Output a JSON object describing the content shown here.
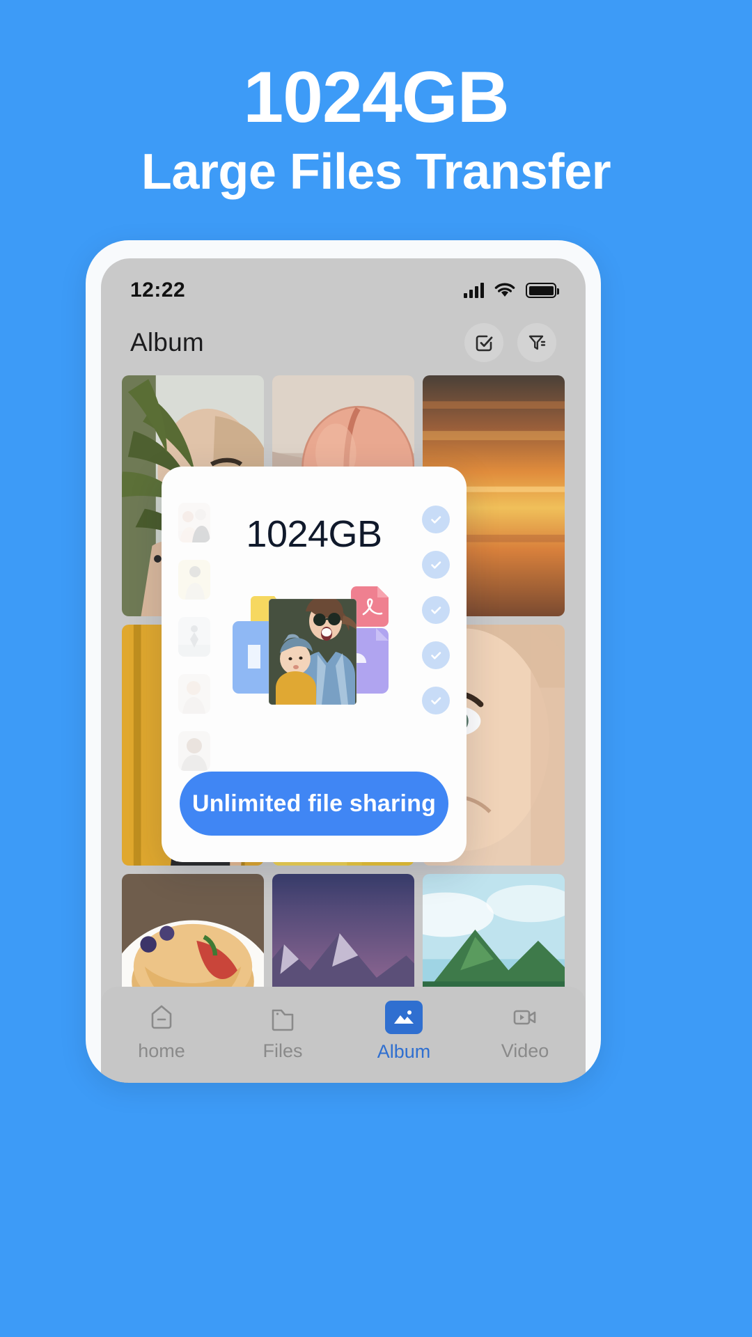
{
  "headline": {
    "line1": "1024GB",
    "line2": "Large Files Transfer"
  },
  "colors": {
    "background": "#3d9bf7",
    "cta": "#4086f4",
    "active_nav": "#2f6fd0",
    "check_circle": "#c8dcf7",
    "modal_title": "#10192b",
    "phone_frame": "#f8fafc",
    "screen": "#c9c9c9",
    "bottom_nav": "#c6c6c6"
  },
  "phone": {
    "statusbar": {
      "time": "12:22",
      "signal_icon": "signal-bars-icon",
      "wifi_icon": "wifi-icon",
      "battery_icon": "battery-full-icon"
    },
    "header": {
      "title": "Album",
      "select_icon": "checkbox-select-icon",
      "filter_icon": "filter-icon"
    },
    "grid": [
      {
        "name": "photo-woman-fern",
        "alt": "Woman holding fern leaf"
      },
      {
        "name": "photo-peach",
        "alt": "Peach on cloth"
      },
      {
        "name": "photo-sunset-water",
        "alt": "Sunset over water"
      },
      {
        "name": "photo-yellow-wall",
        "alt": "Woman against yellow wall"
      },
      {
        "name": "photo-yellow-umbrella",
        "alt": "Yellow abstract"
      },
      {
        "name": "photo-face-closeup",
        "alt": "Face close-up"
      },
      {
        "name": "photo-pancakes",
        "alt": "Pancakes with berries"
      },
      {
        "name": "photo-mountain-lake",
        "alt": "Mountain lake at dusk"
      },
      {
        "name": "photo-tropical-island",
        "alt": "Tropical island huts"
      }
    ],
    "bottom_nav": [
      {
        "label": "home",
        "icon": "home-icon",
        "active": false
      },
      {
        "label": "Files",
        "icon": "folder-icon",
        "active": false
      },
      {
        "label": "Album",
        "icon": "image-icon",
        "active": true
      },
      {
        "label": "Video",
        "icon": "video-icon",
        "active": false
      }
    ]
  },
  "modal": {
    "title": "1024GB",
    "cta_label": "Unlimited file sharing",
    "thumbnails": [
      {
        "name": "thumb-couple",
        "tint": "#efe6e2"
      },
      {
        "name": "thumb-yellow",
        "tint": "#f6efbf"
      },
      {
        "name": "thumb-beach",
        "tint": "#e4e8ec"
      },
      {
        "name": "thumb-portrait",
        "tint": "#efe8e3"
      },
      {
        "name": "thumb-man",
        "tint": "#e7e4e2"
      }
    ],
    "checks": [
      {
        "name": "check-1",
        "icon": "check-circle-icon"
      },
      {
        "name": "check-2",
        "icon": "check-circle-icon"
      },
      {
        "name": "check-3",
        "icon": "check-circle-icon"
      },
      {
        "name": "check-4",
        "icon": "check-circle-icon"
      },
      {
        "name": "check-5",
        "icon": "check-circle-icon"
      }
    ],
    "illustration": {
      "name": "file-sharing-illustration",
      "photo_alt": "Woman with sunglasses holding baby",
      "files": [
        {
          "name": "folder-yellow",
          "color": "#f6d860"
        },
        {
          "name": "file-blue",
          "color": "#8fb8f4"
        },
        {
          "name": "file-pdf",
          "color": "#ef8090",
          "label": "PDF"
        },
        {
          "name": "file-purple",
          "color": "#b0a4f0"
        }
      ]
    }
  }
}
